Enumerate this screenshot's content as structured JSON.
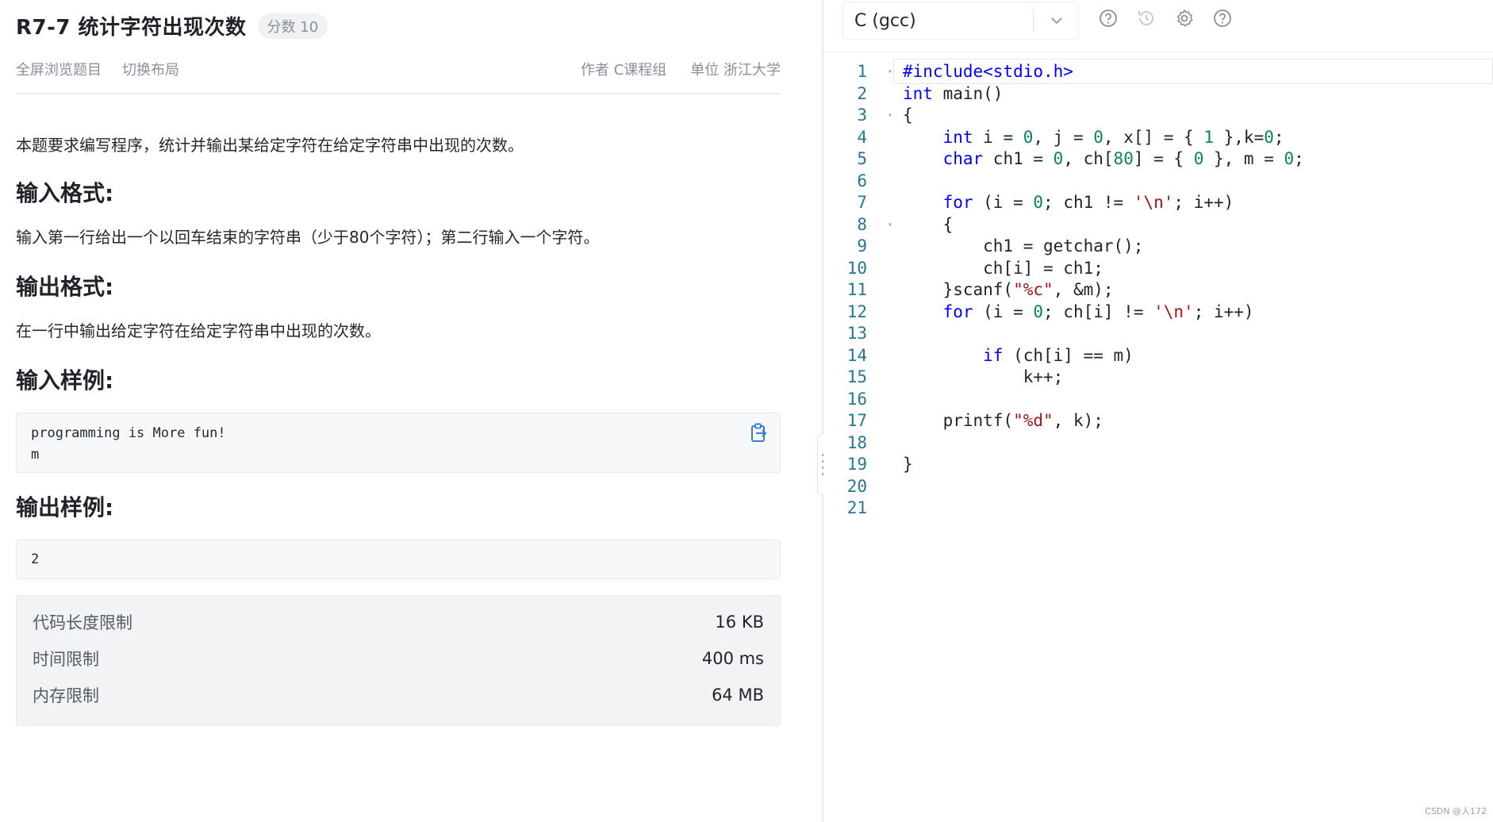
{
  "problem": {
    "title": "R7-7 统计字符出现次数",
    "score_label": "分数 10",
    "fullscreen_link": "全屏浏览题目",
    "layout_link": "切换布局",
    "author": "作者 C课程组",
    "unit": "单位 浙江大学",
    "description": "本题要求编写程序，统计并输出某给定字符在给定字符串中出现的次数。",
    "input_heading": "输入格式:",
    "input_text": "输入第一行给出一个以回车结束的字符串（少于80个字符）；第二行输入一个字符。",
    "output_heading": "输出格式:",
    "output_text": "在一行中输出给定字符在给定字符串中出现的次数。",
    "sample_in_heading": "输入样例:",
    "sample_in_line1": "programming is More fun!",
    "sample_in_line2": "m",
    "sample_out_heading": "输出样例:",
    "sample_out": "2"
  },
  "limits": [
    {
      "label": "代码长度限制",
      "value": "16 KB"
    },
    {
      "label": "时间限制",
      "value": "400 ms"
    },
    {
      "label": "内存限制",
      "value": "64 MB"
    }
  ],
  "editor": {
    "language": "C (gcc)",
    "icons": [
      "help-circle-icon",
      "history-icon",
      "gear-icon",
      "help-circle-icon"
    ],
    "code_lines": [
      "#include<stdio.h>",
      "int main()",
      "{",
      "    int i = 0, j = 0, x[] = { 1 },k=0;",
      "    char ch1 = 0, ch[80] = { 0 }, m = 0;",
      "",
      "    for (i = 0; ch1 != '\\n'; i++)",
      "    {",
      "        ch1 = getchar();",
      "        ch[i] = ch1;",
      "    }scanf(\"%c\", &m);",
      "    for (i = 0; ch[i] != '\\n'; i++)",
      "",
      "        if (ch[i] == m)",
      "            k++;",
      "",
      "    printf(\"%d\", k);",
      "",
      "}",
      "",
      ""
    ]
  },
  "watermark": "CSDN @人172",
  "colors": {
    "keyword": "#0000ff",
    "string": "#a31515",
    "number": "#098658",
    "line_number": "#237893"
  }
}
